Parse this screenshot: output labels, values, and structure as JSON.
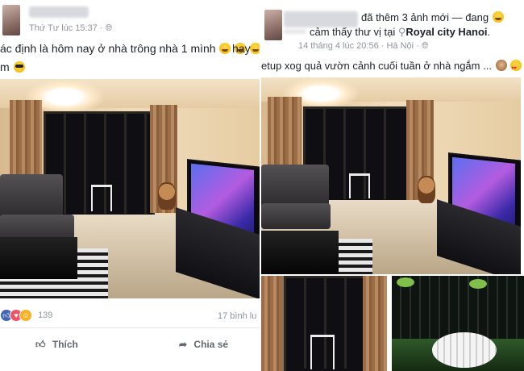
{
  "left_post": {
    "timestamp": "Thứ Tư lúc 15:37",
    "privacy_icon": "globe-icon",
    "text_line1": "ác định là hôm nay ở nhà trông nhà 1 mình",
    "text_line1_tail": "hay",
    "text_line2": "m",
    "reaction_count": "139",
    "comment_count": "17 bình lu",
    "like_label": "Thích",
    "share_label": "Chia sẻ"
  },
  "right_post": {
    "header_text": "đã thêm 3 ảnh mới — đang",
    "feeling_line_prefix": "cảm thấy thư vị tại",
    "place_icon": "pin-icon",
    "place": "Royal city Hanoi",
    "place_suffix": ".",
    "timestamp": "14 tháng 4 lúc 20:56 · Hà Nội ·",
    "text": "etup xog quả vườn cảnh cuối tuần ở nhà ngắm ..."
  },
  "colors": {
    "link": "#1d2129",
    "meta": "#90949c",
    "like_blue": "#4267b2",
    "love_red": "#f25268",
    "haha_yellow": "#f7b125"
  }
}
